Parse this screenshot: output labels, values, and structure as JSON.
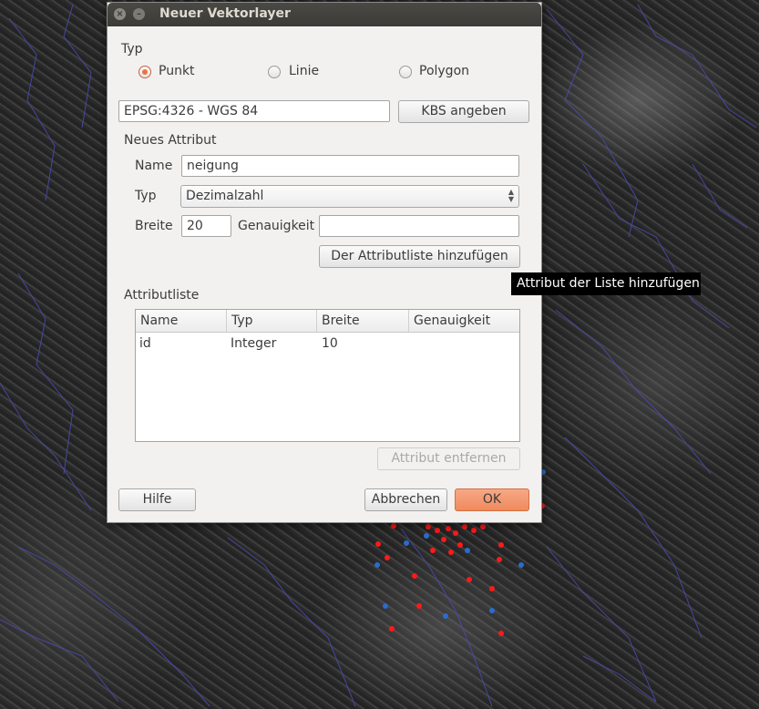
{
  "dialog": {
    "title": "Neuer Vektorlayer"
  },
  "geometry_type": {
    "label": "Typ",
    "options": [
      {
        "label": "Punkt",
        "checked": true
      },
      {
        "label": "Linie",
        "checked": false
      },
      {
        "label": "Polygon",
        "checked": false
      }
    ]
  },
  "crs": {
    "value": "EPSG:4326 - WGS 84",
    "button_label": "KBS angeben"
  },
  "new_attribute": {
    "section_label": "Neues Attribut",
    "name_label": "Name",
    "name_value": "neigung",
    "type_label": "Typ",
    "type_value": "Dezimalzahl",
    "width_label": "Breite",
    "width_value": "20",
    "precision_label": "Genauigkeit",
    "precision_value": "",
    "add_button_label": "Der Attributliste hinzufügen"
  },
  "tooltip": {
    "text": "Attribut der Liste hinzufügen"
  },
  "attribute_list": {
    "section_label": "Attributliste",
    "columns": [
      "Name",
      "Typ",
      "Breite",
      "Genauigkeit"
    ],
    "rows": [
      [
        "id",
        "Integer",
        "10",
        ""
      ]
    ],
    "remove_button_label": "Attribut entfernen"
  },
  "footer": {
    "help_label": "Hilfe",
    "cancel_label": "Abbrechen",
    "ok_label": "OK"
  },
  "colors": {
    "accent": "#ef8a5d",
    "title_bg": "#3c3b37",
    "map_points_red": "#ff1a1a",
    "map_points_blue": "#2a6ccf",
    "map_lines": "#4a4ab0"
  }
}
